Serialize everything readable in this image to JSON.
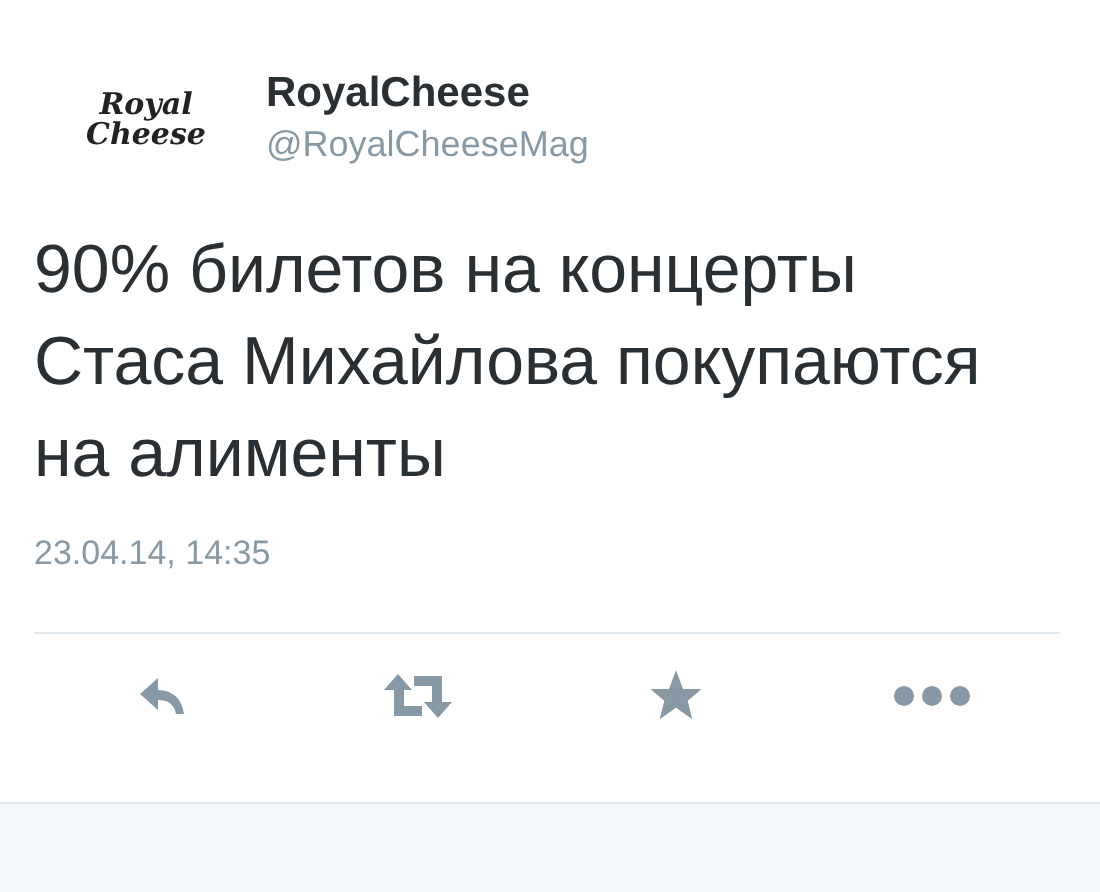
{
  "account": {
    "logo_lines": [
      "Royal",
      "Cheese"
    ],
    "name": "RoyalCheese",
    "handle": "@RoyalCheeseMag"
  },
  "tweet": {
    "text": "90% билетов на концерты Стаса Михайлова покупаются на алименты",
    "timestamp": "23.04.14, 14:35"
  },
  "actions": [
    {
      "kind": "reply"
    },
    {
      "kind": "retweet"
    },
    {
      "kind": "favorite"
    },
    {
      "kind": "more"
    }
  ]
}
